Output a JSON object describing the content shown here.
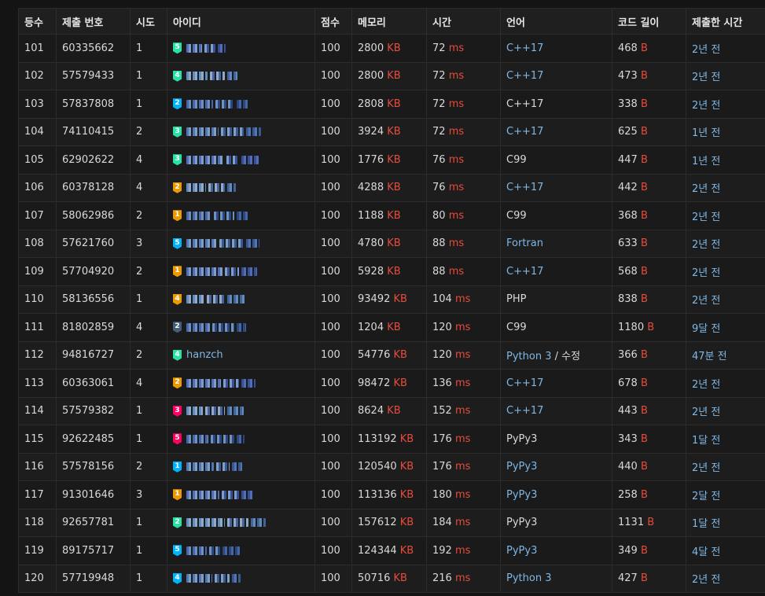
{
  "headers": {
    "rank": "등수",
    "submission_id": "제출 번호",
    "attempts": "시도",
    "user_id": "아이디",
    "score": "점수",
    "memory": "메모리",
    "time": "시간",
    "language": "언어",
    "code_length": "코드 길이",
    "submitted_at": "제출한 시간"
  },
  "units": {
    "memory": "KB",
    "time": "ms",
    "length": "B"
  },
  "colors": {
    "link": "#7fb7e6",
    "unit": "#e74c3c",
    "tier_platinum": "#27e2a4",
    "tier_gold": "#ec9a00",
    "tier_ruby": "#ff0062",
    "tier_diamond": "#00b4fc",
    "tier_silver": "#435f7a"
  },
  "rows": [
    {
      "rank": "101",
      "submission_id": "60335662",
      "attempts": "1",
      "tier": "platinum",
      "tier_level": "5",
      "user": "",
      "score": "100",
      "memory": "2800",
      "time": "72",
      "language": "C++17",
      "language_link": true,
      "code_length": "468",
      "submitted_at": "2년 전"
    },
    {
      "rank": "102",
      "submission_id": "57579433",
      "attempts": "1",
      "tier": "platinum",
      "tier_level": "4",
      "user": "",
      "score": "100",
      "memory": "2800",
      "time": "72",
      "language": "C++17",
      "language_link": true,
      "code_length": "473",
      "submitted_at": "2년 전"
    },
    {
      "rank": "103",
      "submission_id": "57837808",
      "attempts": "1",
      "tier": "diamond",
      "tier_level": "2",
      "user": "",
      "score": "100",
      "memory": "2808",
      "time": "72",
      "language": "C++17",
      "language_link": false,
      "code_length": "338",
      "submitted_at": "2년 전"
    },
    {
      "rank": "104",
      "submission_id": "74110415",
      "attempts": "2",
      "tier": "platinum",
      "tier_level": "3",
      "user": "",
      "score": "100",
      "memory": "3924",
      "time": "72",
      "language": "C++17",
      "language_link": true,
      "code_length": "625",
      "submitted_at": "1년 전"
    },
    {
      "rank": "105",
      "submission_id": "62902622",
      "attempts": "4",
      "tier": "platinum",
      "tier_level": "3",
      "user": "",
      "score": "100",
      "memory": "1776",
      "time": "76",
      "language": "C99",
      "language_link": false,
      "code_length": "447",
      "submitted_at": "1년 전"
    },
    {
      "rank": "106",
      "submission_id": "60378128",
      "attempts": "4",
      "tier": "gold",
      "tier_level": "2",
      "user": "",
      "score": "100",
      "memory": "4288",
      "time": "76",
      "language": "C++17",
      "language_link": true,
      "code_length": "442",
      "submitted_at": "2년 전"
    },
    {
      "rank": "107",
      "submission_id": "58062986",
      "attempts": "2",
      "tier": "gold",
      "tier_level": "1",
      "user": "",
      "score": "100",
      "memory": "1188",
      "time": "80",
      "language": "C99",
      "language_link": false,
      "code_length": "368",
      "submitted_at": "2년 전"
    },
    {
      "rank": "108",
      "submission_id": "57621760",
      "attempts": "3",
      "tier": "diamond",
      "tier_level": "5",
      "user": "",
      "score": "100",
      "memory": "4780",
      "time": "88",
      "language": "Fortran",
      "language_link": true,
      "code_length": "633",
      "submitted_at": "2년 전"
    },
    {
      "rank": "109",
      "submission_id": "57704920",
      "attempts": "2",
      "tier": "gold",
      "tier_level": "1",
      "user": "",
      "score": "100",
      "memory": "5928",
      "time": "88",
      "language": "C++17",
      "language_link": true,
      "code_length": "568",
      "submitted_at": "2년 전"
    },
    {
      "rank": "110",
      "submission_id": "58136556",
      "attempts": "1",
      "tier": "gold",
      "tier_level": "4",
      "user": "",
      "score": "100",
      "memory": "93492",
      "time": "104",
      "language": "PHP",
      "language_link": false,
      "code_length": "838",
      "submitted_at": "2년 전"
    },
    {
      "rank": "111",
      "submission_id": "81802859",
      "attempts": "4",
      "tier": "silver",
      "tier_level": "2",
      "user": "",
      "score": "100",
      "memory": "1204",
      "time": "120",
      "language": "C99",
      "language_link": false,
      "code_length": "1180",
      "submitted_at": "9달 전"
    },
    {
      "rank": "112",
      "submission_id": "94816727",
      "attempts": "2",
      "tier": "platinum",
      "tier_level": "4",
      "user": "hanzch",
      "score": "100",
      "memory": "54776",
      "time": "120",
      "language": "Python 3",
      "language_link": true,
      "edit_label": "수정",
      "code_length": "366",
      "submitted_at": "47분 전"
    },
    {
      "rank": "113",
      "submission_id": "60363061",
      "attempts": "4",
      "tier": "gold",
      "tier_level": "2",
      "user": "",
      "score": "100",
      "memory": "98472",
      "time": "136",
      "language": "C++17",
      "language_link": true,
      "code_length": "678",
      "submitted_at": "2년 전"
    },
    {
      "rank": "114",
      "submission_id": "57579382",
      "attempts": "1",
      "tier": "ruby",
      "tier_level": "3",
      "user": "",
      "score": "100",
      "memory": "8624",
      "time": "152",
      "language": "C++17",
      "language_link": true,
      "code_length": "443",
      "submitted_at": "2년 전"
    },
    {
      "rank": "115",
      "submission_id": "92622485",
      "attempts": "1",
      "tier": "ruby",
      "tier_level": "5",
      "user": "",
      "score": "100",
      "memory": "113192",
      "time": "176",
      "language": "PyPy3",
      "language_link": false,
      "code_length": "343",
      "submitted_at": "1달 전"
    },
    {
      "rank": "116",
      "submission_id": "57578156",
      "attempts": "2",
      "tier": "diamond",
      "tier_level": "1",
      "user": "",
      "score": "100",
      "memory": "120540",
      "time": "176",
      "language": "PyPy3",
      "language_link": true,
      "code_length": "440",
      "submitted_at": "2년 전"
    },
    {
      "rank": "117",
      "submission_id": "91301646",
      "attempts": "3",
      "tier": "gold",
      "tier_level": "1",
      "user": "",
      "score": "100",
      "memory": "113136",
      "time": "180",
      "language": "PyPy3",
      "language_link": true,
      "code_length": "258",
      "submitted_at": "2달 전"
    },
    {
      "rank": "118",
      "submission_id": "92657781",
      "attempts": "1",
      "tier": "platinum",
      "tier_level": "2",
      "user": "",
      "score": "100",
      "memory": "157612",
      "time": "184",
      "language": "PyPy3",
      "language_link": false,
      "code_length": "1131",
      "submitted_at": "1달 전"
    },
    {
      "rank": "119",
      "submission_id": "89175717",
      "attempts": "1",
      "tier": "diamond",
      "tier_level": "5",
      "user": "",
      "score": "100",
      "memory": "124344",
      "time": "192",
      "language": "PyPy3",
      "language_link": true,
      "code_length": "349",
      "submitted_at": "4달 전"
    },
    {
      "rank": "120",
      "submission_id": "57719948",
      "attempts": "1",
      "tier": "diamond",
      "tier_level": "4",
      "user": "",
      "score": "100",
      "memory": "50716",
      "time": "216",
      "language": "Python 3",
      "language_link": true,
      "code_length": "427",
      "submitted_at": "2년 전"
    }
  ]
}
